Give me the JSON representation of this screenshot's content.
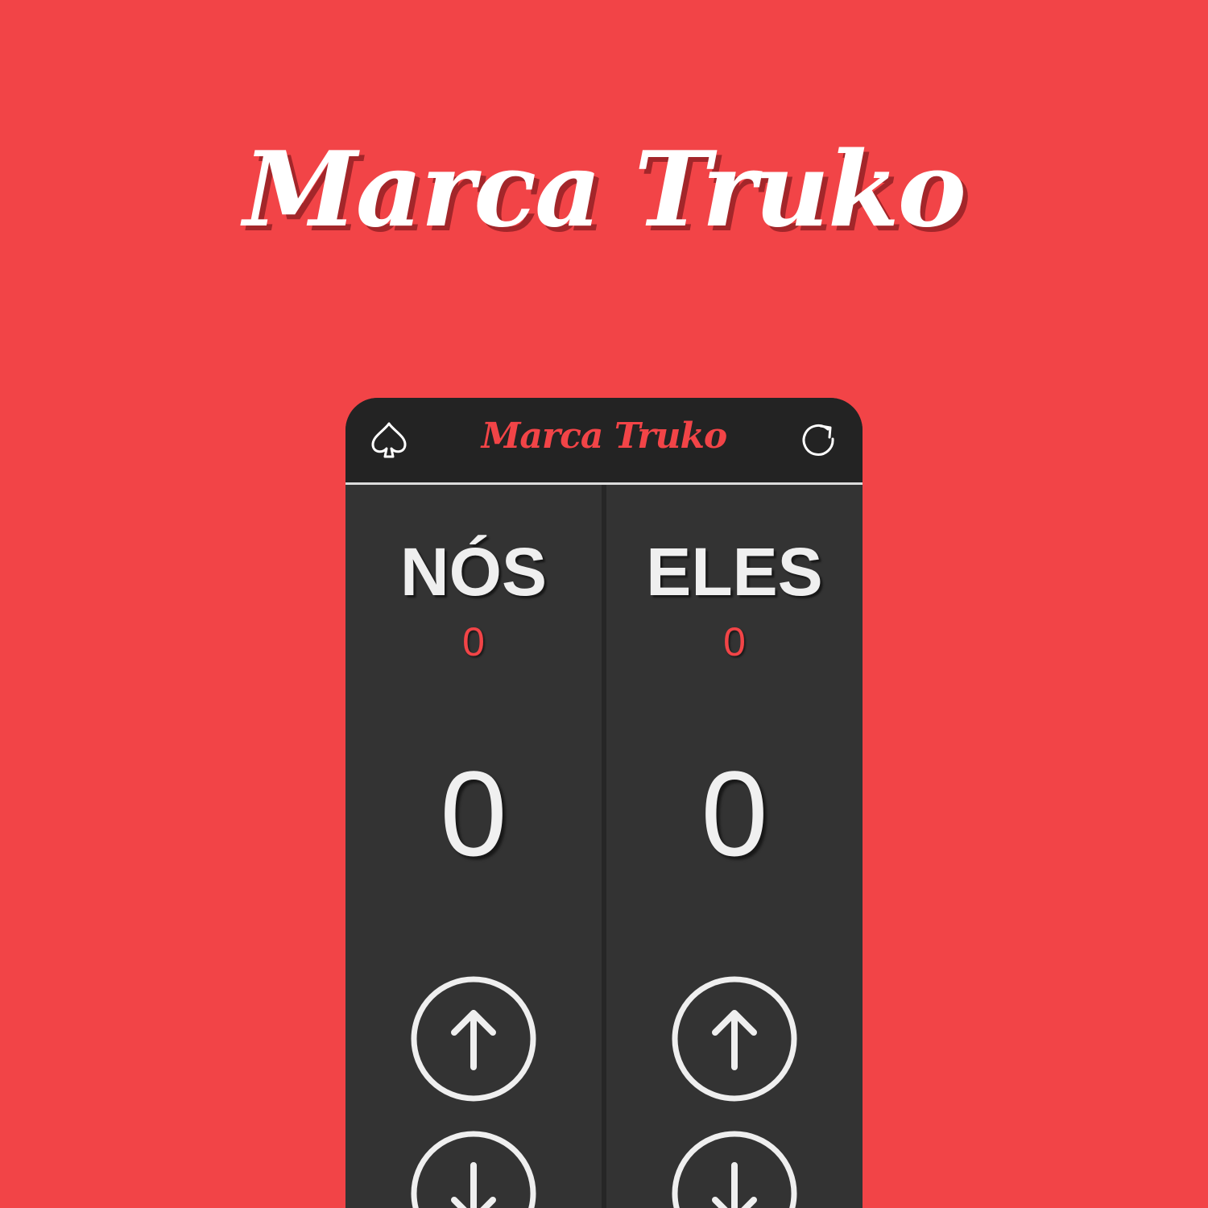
{
  "promo": {
    "title": "Marca Truko"
  },
  "header": {
    "title": "Marca Truko",
    "left_icon": "spade-icon",
    "right_icon": "refresh-icon"
  },
  "teams": [
    {
      "name": "NÓS",
      "games": "0",
      "score": "0"
    },
    {
      "name": "ELES",
      "games": "0",
      "score": "0"
    }
  ],
  "colors": {
    "background": "#f24447",
    "accent": "#f24447",
    "panel": "#333333",
    "header": "#232323",
    "text": "#f0f0f0"
  },
  "icons": {
    "increment": "arrow-up-circle-icon",
    "decrement": "arrow-down-circle-icon"
  }
}
